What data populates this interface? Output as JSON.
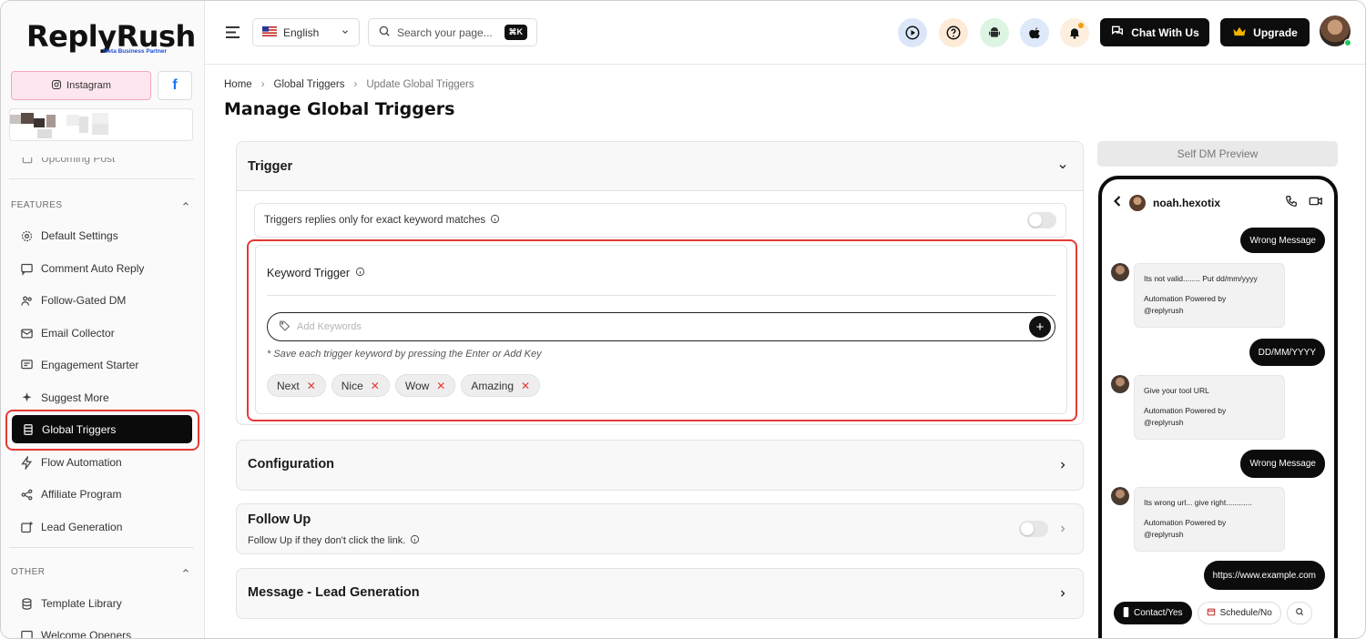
{
  "brand": {
    "name": "ReplyRush",
    "partner": "Meta Business Partner"
  },
  "sidebar": {
    "instagram_label": "Instagram",
    "facebook_label": "f",
    "truncated_item": "Upcoming Post",
    "features_heading": "FEATURES",
    "other_heading": "OTHER",
    "features": [
      {
        "label": "Default Settings",
        "icon": "gear-icon"
      },
      {
        "label": "Comment Auto Reply",
        "icon": "comment-icon"
      },
      {
        "label": "Follow-Gated DM",
        "icon": "users-icon"
      },
      {
        "label": "Email Collector",
        "icon": "mail-icon"
      },
      {
        "label": "Engagement Starter",
        "icon": "chat-icon"
      },
      {
        "label": "Suggest More",
        "icon": "sparkle-icon"
      },
      {
        "label": "Global Triggers",
        "icon": "list-icon",
        "active": true
      },
      {
        "label": "Flow Automation",
        "icon": "bolt-icon"
      },
      {
        "label": "Affiliate Program",
        "icon": "share-icon"
      },
      {
        "label": "Lead Generation",
        "icon": "plus-square-icon"
      }
    ],
    "other": [
      {
        "label": "Template Library",
        "icon": "database-icon"
      },
      {
        "label": "Welcome Openers",
        "icon": "wave-icon"
      }
    ]
  },
  "header": {
    "language": "English",
    "search_placeholder": "Search your page...",
    "shortcut": "⌘K",
    "chat_button": "Chat With Us",
    "upgrade_button": "Upgrade",
    "icon_colors": [
      "#dbe7f8",
      "#fdebd7",
      "#dcf5e3",
      "#dde9f9",
      "#fdeede"
    ]
  },
  "breadcrumb": {
    "home": "Home",
    "section": "Global Triggers",
    "current": "Update Global Triggers"
  },
  "page_title": "Manage Global Triggers",
  "trigger": {
    "title": "Trigger",
    "exact_match_label": "Triggers replies only for exact keyword matches",
    "exact_match_on": false,
    "keyword_title": "Keyword Trigger",
    "keyword_placeholder": "Add Keywords",
    "keyword_hint": "* Save each trigger keyword by pressing the Enter or Add Key",
    "keywords": [
      "Next",
      "Nice",
      "Wow",
      "Amazing"
    ]
  },
  "configuration": {
    "title": "Configuration"
  },
  "follow_up": {
    "title": "Follow Up",
    "subtitle": "Follow Up if they don't click the link.",
    "enabled": false
  },
  "lead_message": {
    "title": "Message - Lead Generation"
  },
  "preview": {
    "button": "Self DM Preview",
    "username": "noah.hexotix",
    "out1": "Wrong Message",
    "in1_text": "Its not valid........ Put dd/mm/yyyy",
    "powered": "Automation Powered by",
    "handle": "@replyrush",
    "out2": "DD/MM/YYYY",
    "in2_text": "Give your tool URL",
    "out3": "Wrong Message",
    "in3_text": "Its wrong url... give right............",
    "out4": "https://www.example.com",
    "chip1": "Contact/Yes",
    "chip2": "Schedule/No"
  },
  "colors": {
    "accent": "#0b0b0b",
    "highlight": "#e53935",
    "instagram_bg": "#fde6ef"
  }
}
